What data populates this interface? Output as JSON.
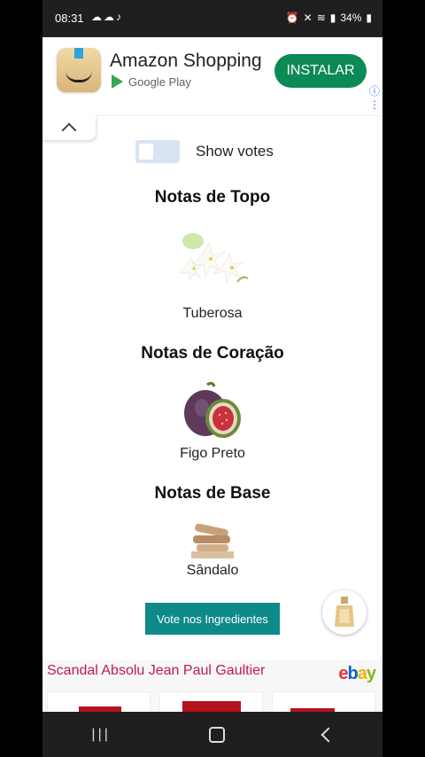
{
  "status_bar": {
    "time": "08:31",
    "battery": "34%",
    "left_icons": [
      "weather-icon",
      "cloud-icon",
      "tiktok-icon"
    ],
    "right_icons": [
      "alarm-icon",
      "mute-icon",
      "wifi-icon",
      "signal-icon",
      "battery-icon"
    ]
  },
  "ad": {
    "title": "Amazon Shopping",
    "subtitle": "Google Play",
    "install_label": "INSTALAR",
    "accent_color": "#0c8a55"
  },
  "toggle": {
    "label": "Show votes",
    "checked": false
  },
  "sections": {
    "top": {
      "title": "Notas de Topo",
      "note": "Tuberosa"
    },
    "heart": {
      "title": "Notas de Coração",
      "note": "Figo Preto"
    },
    "base": {
      "title": "Notas de Base",
      "note": "Sândalo"
    }
  },
  "vote_button": {
    "label": "Vote nos Ingredientes",
    "color": "#0f8a8a"
  },
  "product_strip": {
    "title": "Scandal Absolu Jean Paul Gaultier",
    "brand_logo": "ebay"
  }
}
